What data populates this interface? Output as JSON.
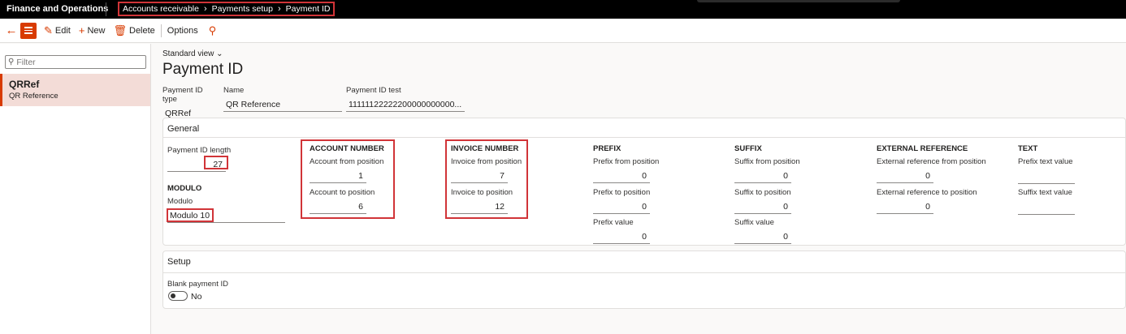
{
  "topbar": {
    "app_title": "Finance and Operations",
    "breadcrumb": [
      "Accounts receivable",
      "Payments setup",
      "Payment ID"
    ]
  },
  "actionbar": {
    "edit_label": "Edit",
    "new_label": "New",
    "delete_label": "Delete",
    "options_label": "Options"
  },
  "list": {
    "filter_placeholder": "Filter",
    "items": [
      {
        "title": "QRRef",
        "subtitle": "QR Reference"
      }
    ]
  },
  "header": {
    "view_label": "Standard view",
    "page_title": "Payment ID",
    "fields": {
      "type_label": "Payment ID type",
      "type_value": "QRRef",
      "name_label": "Name",
      "name_value": "QR Reference",
      "test_label": "Payment ID test",
      "test_value": "11111122222200000000000..."
    }
  },
  "general": {
    "title": "General",
    "length_label": "Payment ID length",
    "length_value": "27",
    "modulo_heading": "MODULO",
    "modulo_label": "Modulo",
    "modulo_value": "Modulo 10",
    "account": {
      "heading": "ACCOUNT NUMBER",
      "from_label": "Account from position",
      "from_value": "1",
      "to_label": "Account to position",
      "to_value": "6"
    },
    "invoice": {
      "heading": "INVOICE NUMBER",
      "from_label": "Invoice from position",
      "from_value": "7",
      "to_label": "Invoice to position",
      "to_value": "12"
    },
    "prefix": {
      "heading": "PREFIX",
      "from_label": "Prefix from position",
      "from_value": "0",
      "to_label": "Prefix to position",
      "to_value": "0",
      "value_label": "Prefix value",
      "value_value": "0"
    },
    "suffix": {
      "heading": "SUFFIX",
      "from_label": "Suffix from position",
      "from_value": "0",
      "to_label": "Suffix to position",
      "to_value": "0",
      "value_label": "Suffix value",
      "value_value": "0"
    },
    "external": {
      "heading": "EXTERNAL REFERENCE",
      "from_label": "External reference from position",
      "from_value": "0",
      "to_label": "External reference to position",
      "to_value": "0"
    },
    "text": {
      "heading": "TEXT",
      "prefix_label": "Prefix text value",
      "prefix_value": "",
      "suffix_label": "Suffix text value",
      "suffix_value": ""
    }
  },
  "setup": {
    "title": "Setup",
    "blank_label": "Blank payment ID",
    "blank_value": "No"
  },
  "colors": {
    "accent": "#d83b01",
    "highlight_border": "#d13438",
    "selected_row": "#f3dcd7",
    "topbar": "#000000"
  },
  "icons": [
    "back-arrow-icon",
    "hamburger-menu-icon",
    "edit-pencil-icon",
    "plus-icon",
    "trash-icon",
    "search-icon",
    "chevron-down-icon",
    "filter-search-icon"
  ]
}
